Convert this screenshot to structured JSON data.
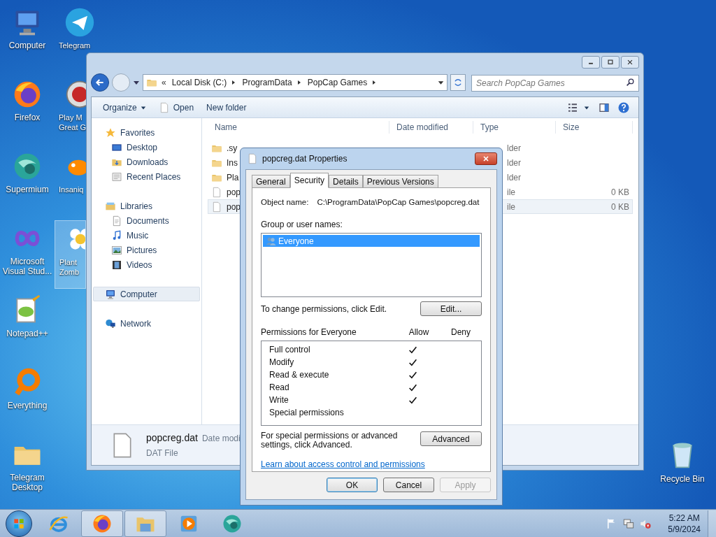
{
  "desktop_icons": [
    {
      "label": "Computer",
      "kind": "computer",
      "selected": false
    },
    {
      "label": "Firefox",
      "kind": "firefox",
      "selected": false
    },
    {
      "label": "Supermium",
      "kind": "supermium",
      "selected": false
    },
    {
      "label": "Microsoft Visual Stud...",
      "kind": "vstudio",
      "selected": false
    },
    {
      "label": "Notepad++",
      "kind": "notepad",
      "selected": false
    },
    {
      "label": "Everything",
      "kind": "everything",
      "selected": false
    },
    {
      "label": "Telegram Desktop",
      "kind": "folder",
      "selected": false
    },
    {
      "label": "Telegram",
      "kind": "telegram",
      "selected": false
    },
    {
      "label": "Play M Great G",
      "kind": "popcap",
      "selected": false
    },
    {
      "label": "Insaniq",
      "kind": "fish",
      "selected": false
    },
    {
      "label": "Plant Zomb",
      "kind": "flower",
      "selected": true
    }
  ],
  "recycle_bin": {
    "label": "Recycle Bin"
  },
  "explorer": {
    "address": {
      "overflow": "«",
      "segments": [
        "Local Disk (C:)",
        "ProgramData",
        "PopCap Games"
      ]
    },
    "search": {
      "placeholder": "Search PopCap Games"
    },
    "toolbar": [
      {
        "label": "Organize",
        "kind": "menu"
      },
      {
        "label": "Open",
        "kind": "open"
      },
      {
        "label": "New folder",
        "kind": "plain"
      }
    ],
    "nav": [
      {
        "label": "Favorites",
        "kind": "star",
        "selected": false,
        "children": [
          {
            "label": "Desktop",
            "kind": "desktop",
            "selected": false
          },
          {
            "label": "Downloads",
            "kind": "downloads",
            "selected": false
          },
          {
            "label": "Recent Places",
            "kind": "recent",
            "selected": false
          }
        ]
      },
      {
        "label": "Libraries",
        "kind": "library",
        "selected": false,
        "children": [
          {
            "label": "Documents",
            "kind": "document",
            "selected": false
          },
          {
            "label": "Music",
            "kind": "music",
            "selected": false
          },
          {
            "label": "Pictures",
            "kind": "pictures",
            "selected": false
          },
          {
            "label": "Videos",
            "kind": "videos",
            "selected": false
          }
        ]
      },
      {
        "label": "Computer",
        "kind": "computer",
        "selected": true
      },
      {
        "label": "Network",
        "kind": "network",
        "selected": false
      }
    ],
    "columns": [
      "Name",
      "Date modified",
      "Type",
      "Size"
    ],
    "rows": [
      {
        "name": ".sy",
        "type": "lder",
        "size": "",
        "kind": "folder",
        "selected": false
      },
      {
        "name": "Ins",
        "type": "lder",
        "size": "",
        "kind": "folder",
        "selected": false
      },
      {
        "name": "Pla",
        "type": "lder",
        "size": "",
        "kind": "folder",
        "selected": false
      },
      {
        "name": "pop",
        "type": "ile",
        "size": "0 KB",
        "kind": "file",
        "selected": false
      },
      {
        "name": "pop",
        "type": "ile",
        "size": "0 KB",
        "kind": "file",
        "selected": true
      }
    ],
    "details": {
      "name": "popcreg.dat",
      "date_label": "Date modi",
      "type": "DAT File"
    }
  },
  "dialog": {
    "title": "popcreg.dat Properties",
    "tabs": [
      {
        "label": "General",
        "selected": false
      },
      {
        "label": "Security",
        "selected": true
      },
      {
        "label": "Details",
        "selected": false
      },
      {
        "label": "Previous Versions",
        "selected": false
      }
    ],
    "object_label": "Object name:",
    "object_name": "C:\\ProgramData\\PopCap Games\\popcreg.dat",
    "group_label": "Group or user names:",
    "users": [
      {
        "name": "Everyone",
        "selected": true
      }
    ],
    "change_text": "To change permissions, click Edit.",
    "edit_button": "Edit...",
    "perm_label": "Permissions for Everyone",
    "allow_label": "Allow",
    "deny_label": "Deny",
    "permissions": [
      {
        "name": "Full control",
        "allow": true,
        "deny": false
      },
      {
        "name": "Modify",
        "allow": true,
        "deny": false
      },
      {
        "name": "Read & execute",
        "allow": true,
        "deny": false
      },
      {
        "name": "Read",
        "allow": true,
        "deny": false
      },
      {
        "name": "Write",
        "allow": true,
        "deny": false
      },
      {
        "name": "Special permissions",
        "allow": false,
        "deny": false
      }
    ],
    "advanced_text": "For special permissions or advanced settings, click Advanced.",
    "advanced_button": "Advanced",
    "link": "Learn about access control and permissions",
    "buttons": [
      {
        "label": "OK",
        "default": true,
        "disabled": false
      },
      {
        "label": "Cancel",
        "default": false,
        "disabled": false
      },
      {
        "label": "Apply",
        "default": false,
        "disabled": true
      }
    ]
  },
  "taskbar": {
    "items": [
      {
        "kind": "ie",
        "active": false
      },
      {
        "kind": "firefox",
        "active": true
      },
      {
        "kind": "explorer",
        "active": true
      },
      {
        "kind": "media",
        "active": false
      },
      {
        "kind": "supermium",
        "active": false
      }
    ],
    "tray": [
      {
        "kind": "flag"
      },
      {
        "kind": "network"
      },
      {
        "kind": "volume-muted"
      }
    ],
    "time": "5:22 AM",
    "date": "5/9/2024"
  }
}
